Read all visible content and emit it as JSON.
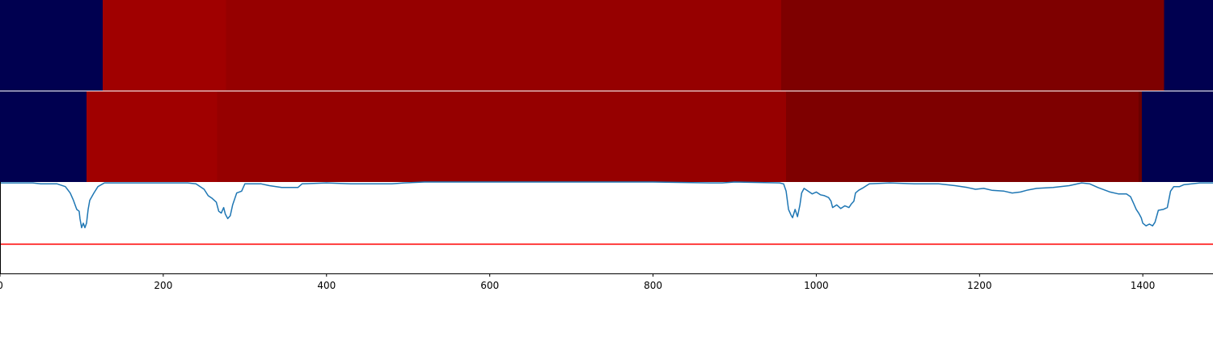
{
  "chart_data": [
    {
      "type": "heatmap",
      "row": "top",
      "x_range": [
        0,
        1486
      ],
      "segments": [
        {
          "start": 0,
          "end": 126,
          "color": "#000050"
        },
        {
          "start": 126,
          "end": 277,
          "color": "#a00000"
        },
        {
          "start": 277,
          "end": 957,
          "color": "#960000"
        },
        {
          "start": 957,
          "end": 1426,
          "color": "#7e0000"
        },
        {
          "start": 1426,
          "end": 1486,
          "color": "#000050"
        }
      ]
    },
    {
      "type": "heatmap",
      "row": "middle",
      "x_range": [
        0,
        1486
      ],
      "segments": [
        {
          "start": 0,
          "end": 106,
          "color": "#000050"
        },
        {
          "start": 106,
          "end": 266,
          "color": "#a00000"
        },
        {
          "start": 266,
          "end": 963,
          "color": "#960000"
        },
        {
          "start": 963,
          "end": 1395,
          "color": "#7e0000"
        },
        {
          "start": 1395,
          "end": 1399,
          "color": "#6a0000"
        },
        {
          "start": 1399,
          "end": 1486,
          "color": "#000050"
        }
      ]
    },
    {
      "type": "line",
      "row": "bottom",
      "xlabel": "",
      "ylabel": "",
      "xlim": [
        0,
        1486
      ],
      "ylim": [
        -1.0,
        0.0
      ],
      "x_ticks": [
        0,
        200,
        400,
        600,
        800,
        1000,
        1200,
        1400
      ],
      "x_tick_labels": [
        "0",
        "200",
        "400",
        "600",
        "800",
        "1000",
        "1200",
        "1400"
      ],
      "threshold": {
        "y": -0.68,
        "color": "#ff0000"
      },
      "series": [
        {
          "color": "#1f77b4",
          "points": [
            [
              0,
              -0.01
            ],
            [
              20,
              -0.01
            ],
            [
              40,
              -0.01
            ],
            [
              50,
              -0.02
            ],
            [
              70,
              -0.02
            ],
            [
              80,
              -0.05
            ],
            [
              86,
              -0.12
            ],
            [
              90,
              -0.2
            ],
            [
              94,
              -0.3
            ],
            [
              97,
              -0.32
            ],
            [
              98,
              -0.4
            ],
            [
              100,
              -0.5
            ],
            [
              102,
              -0.45
            ],
            [
              104,
              -0.5
            ],
            [
              106,
              -0.45
            ],
            [
              108,
              -0.3
            ],
            [
              110,
              -0.2
            ],
            [
              115,
              -0.12
            ],
            [
              120,
              -0.05
            ],
            [
              128,
              -0.01
            ],
            [
              140,
              -0.01
            ],
            [
              180,
              -0.01
            ],
            [
              230,
              -0.01
            ],
            [
              240,
              -0.02
            ],
            [
              250,
              -0.08
            ],
            [
              255,
              -0.15
            ],
            [
              260,
              -0.18
            ],
            [
              265,
              -0.22
            ],
            [
              268,
              -0.32
            ],
            [
              271,
              -0.34
            ],
            [
              274,
              -0.28
            ],
            [
              276,
              -0.35
            ],
            [
              279,
              -0.4
            ],
            [
              282,
              -0.37
            ],
            [
              285,
              -0.25
            ],
            [
              290,
              -0.12
            ],
            [
              296,
              -0.1
            ],
            [
              300,
              -0.02
            ],
            [
              320,
              -0.02
            ],
            [
              330,
              -0.04
            ],
            [
              345,
              -0.06
            ],
            [
              365,
              -0.06
            ],
            [
              370,
              -0.02
            ],
            [
              400,
              -0.01
            ],
            [
              430,
              -0.02
            ],
            [
              480,
              -0.02
            ],
            [
              495,
              -0.01
            ],
            [
              520,
              0.0
            ],
            [
              600,
              0.0
            ],
            [
              700,
              0.0
            ],
            [
              800,
              0.0
            ],
            [
              870,
              -0.01
            ],
            [
              885,
              -0.01
            ],
            [
              900,
              0.0
            ],
            [
              955,
              -0.01
            ],
            [
              960,
              -0.02
            ],
            [
              963,
              -0.1
            ],
            [
              966,
              -0.3
            ],
            [
              969,
              -0.36
            ],
            [
              971,
              -0.39
            ],
            [
              974,
              -0.3
            ],
            [
              977,
              -0.38
            ],
            [
              980,
              -0.25
            ],
            [
              982,
              -0.12
            ],
            [
              985,
              -0.07
            ],
            [
              990,
              -0.1
            ],
            [
              995,
              -0.13
            ],
            [
              1000,
              -0.11
            ],
            [
              1005,
              -0.14
            ],
            [
              1010,
              -0.15
            ],
            [
              1015,
              -0.17
            ],
            [
              1018,
              -0.21
            ],
            [
              1020,
              -0.28
            ],
            [
              1025,
              -0.25
            ],
            [
              1030,
              -0.29
            ],
            [
              1035,
              -0.26
            ],
            [
              1040,
              -0.28
            ],
            [
              1043,
              -0.24
            ],
            [
              1046,
              -0.21
            ],
            [
              1048,
              -0.12
            ],
            [
              1052,
              -0.09
            ],
            [
              1058,
              -0.06
            ],
            [
              1065,
              -0.02
            ],
            [
              1090,
              -0.01
            ],
            [
              1120,
              -0.02
            ],
            [
              1150,
              -0.02
            ],
            [
              1170,
              -0.04
            ],
            [
              1185,
              -0.06
            ],
            [
              1195,
              -0.08
            ],
            [
              1205,
              -0.07
            ],
            [
              1215,
              -0.09
            ],
            [
              1230,
              -0.1
            ],
            [
              1240,
              -0.12
            ],
            [
              1250,
              -0.11
            ],
            [
              1258,
              -0.09
            ],
            [
              1270,
              -0.07
            ],
            [
              1290,
              -0.06
            ],
            [
              1310,
              -0.04
            ],
            [
              1325,
              -0.01
            ],
            [
              1335,
              -0.02
            ],
            [
              1345,
              -0.06
            ],
            [
              1360,
              -0.11
            ],
            [
              1370,
              -0.13
            ],
            [
              1380,
              -0.13
            ],
            [
              1385,
              -0.16
            ],
            [
              1389,
              -0.24
            ],
            [
              1392,
              -0.3
            ],
            [
              1395,
              -0.34
            ],
            [
              1398,
              -0.39
            ],
            [
              1400,
              -0.45
            ],
            [
              1404,
              -0.48
            ],
            [
              1408,
              -0.46
            ],
            [
              1412,
              -0.48
            ],
            [
              1415,
              -0.44
            ],
            [
              1419,
              -0.31
            ],
            [
              1425,
              -0.3
            ],
            [
              1430,
              -0.28
            ],
            [
              1434,
              -0.1
            ],
            [
              1438,
              -0.05
            ],
            [
              1445,
              -0.05
            ],
            [
              1450,
              -0.03
            ],
            [
              1460,
              -0.02
            ],
            [
              1470,
              -0.01
            ],
            [
              1486,
              -0.01
            ]
          ]
        }
      ]
    }
  ]
}
